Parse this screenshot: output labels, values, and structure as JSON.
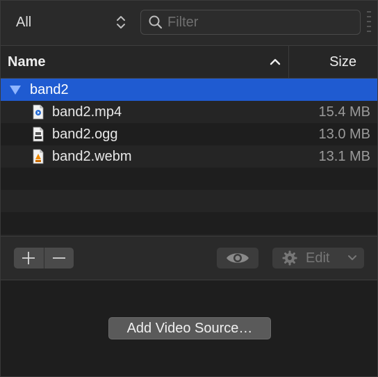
{
  "toolbar": {
    "scope_label": "All",
    "filter_placeholder": "Filter",
    "filter_value": ""
  },
  "header": {
    "name_label": "Name",
    "size_label": "Size"
  },
  "group": {
    "name": "band2"
  },
  "files": [
    {
      "name": "band2.mp4",
      "size": "15.4 MB",
      "icon": "mp4-file-icon"
    },
    {
      "name": "band2.ogg",
      "size": "13.0 MB",
      "icon": "ogg-file-icon"
    },
    {
      "name": "band2.webm",
      "size": "13.1 MB",
      "icon": "webm-file-icon"
    }
  ],
  "bottom_bar": {
    "edit_label": "Edit"
  },
  "add_source_label": "Add Video Source…",
  "colors": {
    "selection": "#1f5bd1",
    "background": "#1e1e1e"
  }
}
